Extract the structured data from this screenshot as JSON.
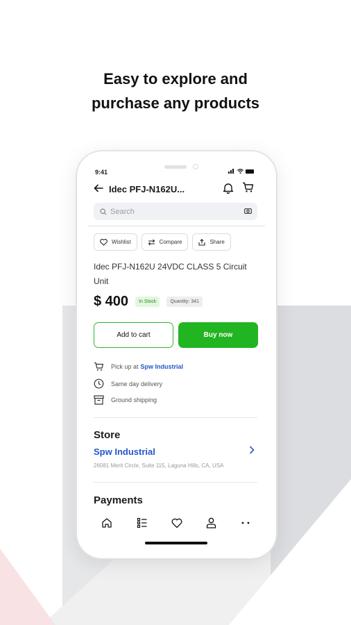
{
  "headline": {
    "line1": "Easy to explore and",
    "line2": "purchase any products"
  },
  "status_bar": {
    "time": "9:41"
  },
  "header": {
    "title": "Idec PFJ-N162U..."
  },
  "search": {
    "placeholder": "Search"
  },
  "actions": [
    {
      "label": "Wishlist",
      "icon": "heart-icon"
    },
    {
      "label": "Compare",
      "icon": "compare-icon"
    },
    {
      "label": "Share",
      "icon": "share-icon"
    }
  ],
  "product": {
    "name": "Idec PFJ-N162U 24VDC CLASS 5 Circuit Unit",
    "price": "$ 400",
    "stock": "In Stock",
    "quantity": "Quantity: 341"
  },
  "buttons": {
    "add_to_cart": "Add to cart",
    "buy_now": "Buy now"
  },
  "delivery": {
    "pickup_prefix": "Pick up at",
    "pickup_store": "Spw Industrial",
    "same_day": "Same day delivery",
    "ground": "Ground shipping"
  },
  "store": {
    "title": "Store",
    "name": "Spw Industrial",
    "address": "26081 Merit Circle, Suite 115, Laguna Hills, CA, USA"
  },
  "payments": {
    "title": "Payments"
  },
  "bottom_nav": [
    "home-icon",
    "catalog-icon",
    "favorites-icon",
    "profile-icon",
    "more-icon"
  ],
  "colors": {
    "accent_green": "#22b522",
    "link_blue": "#2457c9"
  }
}
